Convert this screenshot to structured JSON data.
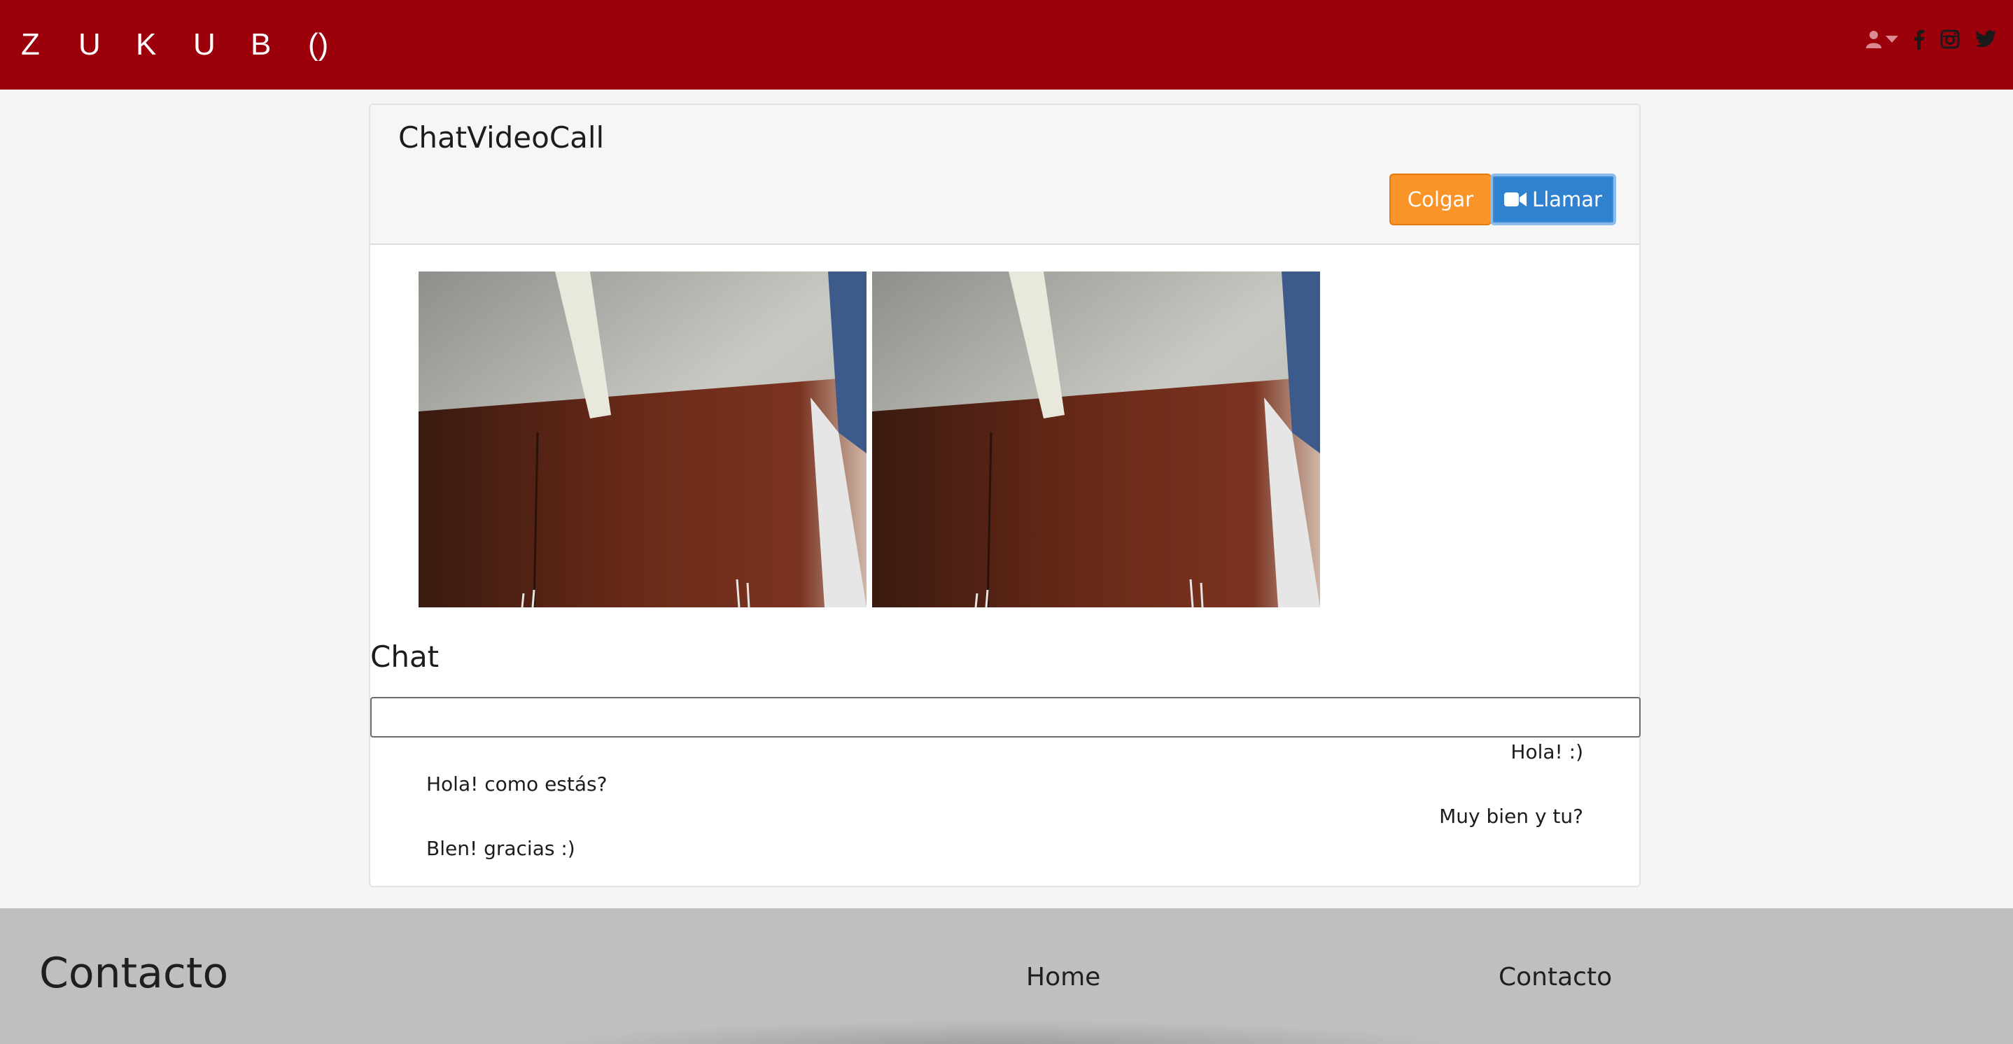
{
  "header": {
    "brand_letters": [
      "Z",
      "U",
      "K",
      "U",
      "B",
      "()"
    ],
    "icons": [
      "user-icon",
      "caret-down-icon",
      "facebook-icon",
      "instagram-icon",
      "twitter-icon"
    ]
  },
  "panel": {
    "title": "ChatVideoCall",
    "hangup_label": "Colgar",
    "call_label": "Llamar"
  },
  "videos": [
    {
      "name": "local-video"
    },
    {
      "name": "remote-video"
    }
  ],
  "chat": {
    "heading": "Chat",
    "input_value": "",
    "messages": [
      {
        "text": "Hola! :)",
        "side": "right"
      },
      {
        "text": "Hola! como estás?",
        "side": "left"
      },
      {
        "text": "Muy bien y tu?",
        "side": "right"
      },
      {
        "text": "Blen! gracias :)",
        "side": "left"
      }
    ]
  },
  "footer": {
    "title": "Contacto",
    "links": [
      "Home",
      "Contacto"
    ]
  },
  "colors": {
    "header_bg": "#9b000b",
    "hangup": "#fb9428",
    "call": "#2f82d0",
    "footer_bg": "#bfbfbf"
  }
}
